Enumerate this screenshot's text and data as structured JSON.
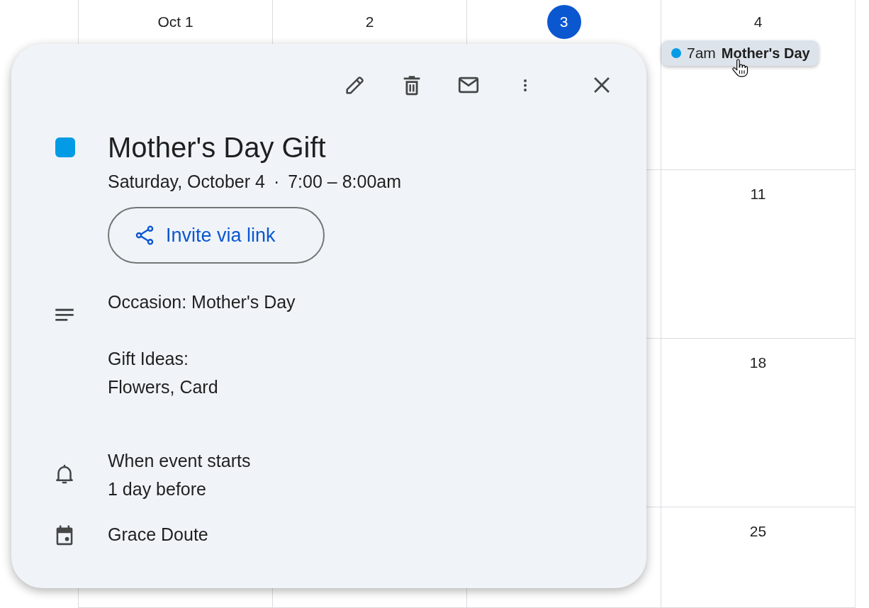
{
  "calendar": {
    "days": [
      {
        "date": "Oct 1",
        "today": false
      },
      {
        "date": "2",
        "today": false
      },
      {
        "date": "3",
        "today": true
      },
      {
        "date": "4",
        "today": false,
        "events": [
          {
            "time": "7am",
            "title": "Mother's Day",
            "color": "#039be5"
          }
        ]
      }
    ],
    "later_weeks": [
      {
        "sat_date": "11"
      },
      {
        "sat_date": "18"
      },
      {
        "sat_date": "25"
      }
    ]
  },
  "event_popup": {
    "toolbar": [
      {
        "kind": "edit"
      },
      {
        "kind": "delete"
      },
      {
        "kind": "email"
      },
      {
        "kind": "more"
      },
      {
        "kind": "close"
      }
    ],
    "color": "#039be5",
    "title": "Mother's Day Gift",
    "date": "Saturday, October 4",
    "separator": "·",
    "time": "7:00 – 8:00am",
    "invite_button": "Invite via link",
    "description": [
      "Occasion: Mother's Day",
      "Gift Ideas:\nFlowers, Card"
    ],
    "reminders": [
      "When event starts",
      "1 day before"
    ],
    "calendar": "Grace Doute"
  }
}
